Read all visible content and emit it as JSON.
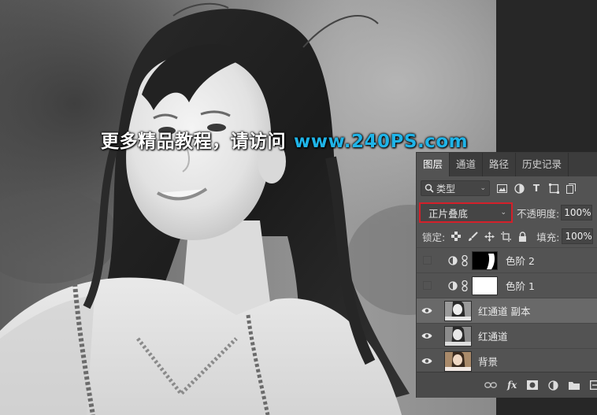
{
  "watermark": {
    "text_cn": "更多精品教程，请访问",
    "text_url": "www.240PS.com",
    "url_color": "#1fb4e8"
  },
  "panel": {
    "tabs": [
      {
        "label": "图层",
        "active": true
      },
      {
        "label": "通道",
        "active": false
      },
      {
        "label": "路径",
        "active": false
      },
      {
        "label": "历史记录",
        "active": false
      }
    ],
    "filter": {
      "kind_label": "类型",
      "icons": [
        "image-filter-icon",
        "adjustment-filter-icon",
        "type-filter-icon",
        "shape-filter-icon",
        "smart-object-filter-icon"
      ]
    },
    "blend_mode": "正片叠底",
    "opacity_label": "不透明度:",
    "opacity_value": "100%",
    "lock_label": "锁定:",
    "lock_icons": [
      "lock-transparent-icon",
      "lock-image-icon",
      "lock-position-icon",
      "lock-artboard-icon",
      "lock-all-icon"
    ],
    "fill_label": "填充:",
    "fill_value": "100%",
    "layers": [
      {
        "name": "色阶 2",
        "type": "adjustment",
        "visible": false,
        "selected": false
      },
      {
        "name": "色阶 1",
        "type": "adjustment",
        "visible": false,
        "selected": false
      },
      {
        "name": "红通道 副本",
        "type": "pixel",
        "visible": true,
        "selected": true
      },
      {
        "name": "红通道",
        "type": "pixel",
        "visible": true,
        "selected": false
      },
      {
        "name": "背景",
        "type": "pixel",
        "visible": true,
        "selected": false
      }
    ],
    "footer_icons": [
      "link-layers-icon",
      "fx-icon",
      "add-mask-icon",
      "new-adjustment-icon",
      "new-group-icon",
      "new-layer-icon"
    ],
    "footer_fx": "fx"
  },
  "colors": {
    "panel_bg": "#535353",
    "tab_bar": "#3c3c3c",
    "selected_row": "#696969",
    "highlight_border": "#d4202a"
  }
}
